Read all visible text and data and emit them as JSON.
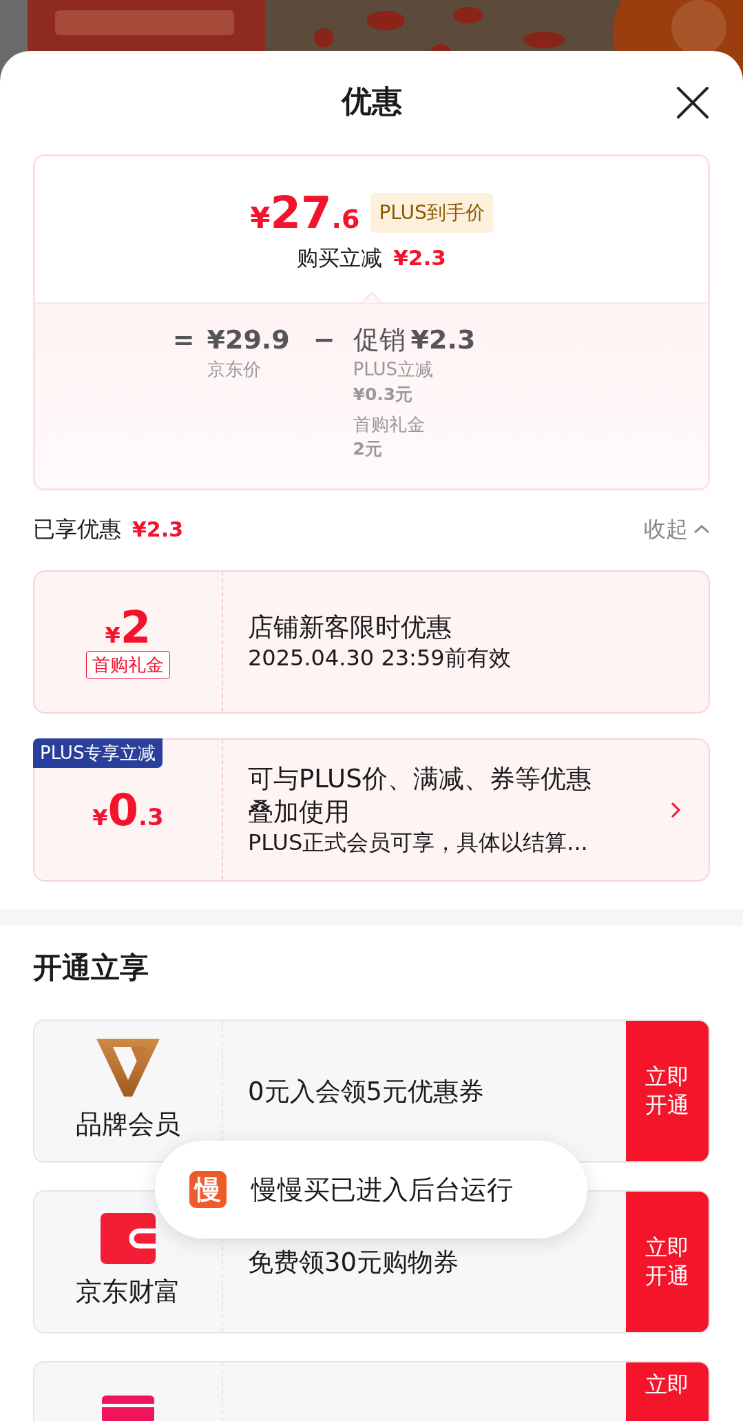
{
  "sheet": {
    "title": "优惠"
  },
  "price_card": {
    "price_symbol": "¥",
    "price_int": "27",
    "price_dec": ".6",
    "price_badge": "PLUS到手价",
    "instant_label": "购买立减",
    "instant_amount": "¥2.3",
    "equals": "=",
    "jd_price": "¥29.9",
    "jd_price_label": "京东价",
    "minus": "−",
    "promo_label": "促销",
    "promo_amount": "¥2.3",
    "promo_items": [
      {
        "label": "PLUS立减",
        "value": "¥0.3元"
      },
      {
        "label": "首购礼金",
        "value": "2元"
      }
    ]
  },
  "enjoyed": {
    "label": "已享优惠",
    "amount": "¥2.3",
    "toggle": "收起",
    "expanded": true
  },
  "coupons": [
    {
      "symbol": "¥",
      "amount_int": "2",
      "tag": "首购礼金",
      "title": "店铺新客限时优惠",
      "subtitle": "2025.04.30 23:59前有效",
      "has_arrow": false
    },
    {
      "corner_badge": "PLUS专享立减",
      "symbol": "¥",
      "amount_int": "0",
      "amount_dec": ".3",
      "title": "可与PLUS价、满减、券等优惠叠加使用",
      "subtitle": "PLUS正式会员可享，具体以结算...",
      "has_arrow": true
    }
  ],
  "section": {
    "title": "开通立享"
  },
  "memberships": [
    {
      "kind": "brand",
      "name": "品牌会员",
      "offer": "0元入会领5元优惠券",
      "button": "立即开通"
    },
    {
      "kind": "wallet",
      "name": "京东财富",
      "offer": "免费领30元购物券",
      "button": "立即开通"
    },
    {
      "kind": "card",
      "button": "立即"
    }
  ],
  "toast": {
    "icon_char": "慢",
    "text": "慢慢买已进入后台运行"
  }
}
